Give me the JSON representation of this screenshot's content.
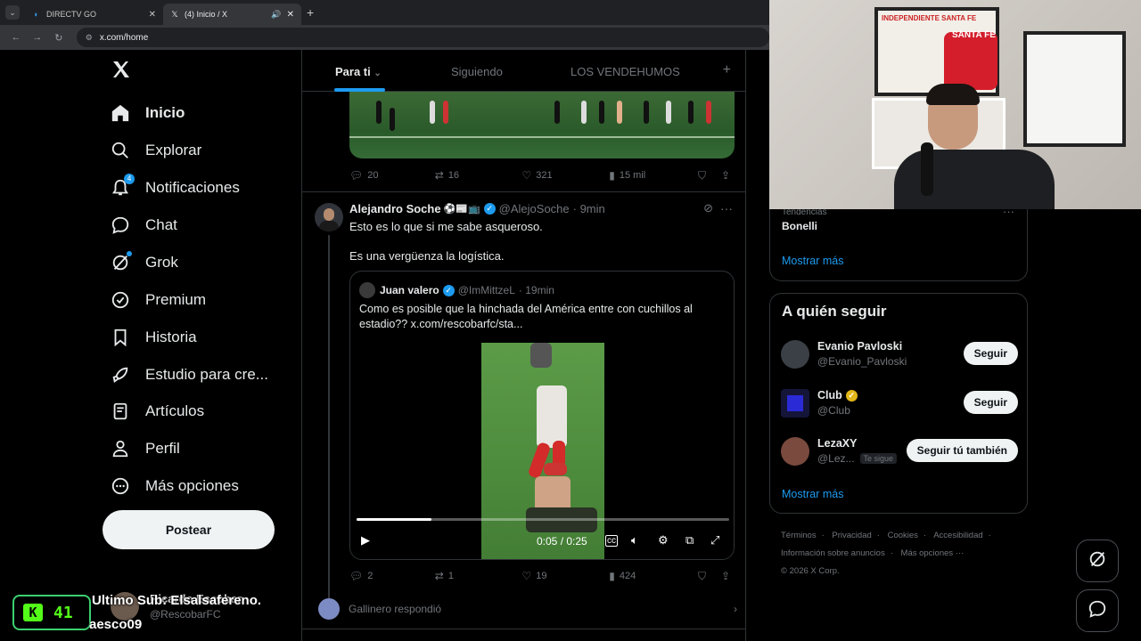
{
  "browser": {
    "tabs": [
      {
        "title": "DIRECTV GO",
        "icon": "directv-icon",
        "close": "✕"
      },
      {
        "title": "(4) Inicio / X",
        "icon": "x-logo-icon",
        "close": "✕",
        "audio": "🔊"
      }
    ],
    "new_tab": "+",
    "url": "x.com/home"
  },
  "nav": {
    "logo": "X",
    "items": [
      {
        "label": "Inicio",
        "icon": "home-icon"
      },
      {
        "label": "Explorar",
        "icon": "search-icon"
      },
      {
        "label": "Notificaciones",
        "icon": "bell-icon",
        "badge": "4"
      },
      {
        "label": "Chat",
        "icon": "chat-bubble-icon"
      },
      {
        "label": "Grok",
        "icon": "grok-icon"
      },
      {
        "label": "Premium",
        "icon": "premium-badge-icon"
      },
      {
        "label": "Historia",
        "icon": "bookmark-icon"
      },
      {
        "label": "Estudio para cre...",
        "icon": "rocket-icon"
      },
      {
        "label": "Artículos",
        "icon": "article-icon"
      },
      {
        "label": "Perfil",
        "icon": "person-icon"
      },
      {
        "label": "Más opciones",
        "icon": "more-circle-icon"
      }
    ],
    "post_button": "Postear",
    "account": {
      "name": "Ricardo Escobar",
      "handle": "@RescobarFC"
    }
  },
  "overlay": {
    "counter": "41",
    "counter_letter": "K",
    "sub_line": "Ultimo Sub: Elsalsafereno.",
    "sub_line2": "aesco09"
  },
  "timeline": {
    "tabs": [
      "Para ti",
      "Siguiendo",
      "LOS VENDEHUMOS"
    ],
    "plus": "+",
    "prev_actions": {
      "replies": "20",
      "reposts": "16",
      "likes": "321",
      "views": "15 mil"
    },
    "tweet": {
      "name": "Alejandro Soche",
      "emojis": "⚽📰📺",
      "handle": "@AlejoSoche",
      "time": "· 9min",
      "text1": "Esto es lo que si me sabe asqueroso.",
      "text2": "Es una vergüenza la logística.",
      "quote": {
        "name": "Juan valero",
        "handle": "@ImMittzeL",
        "time": "· 19min",
        "text": "Como es posible que la hinchada del América entre con cuchillos al estadio?? x.com/rescobarfc/sta...",
        "video_time": "0:05 / 0:25",
        "progress": 0.2
      },
      "actions": {
        "replies": "2",
        "reposts": "1",
        "likes": "19",
        "views": "424"
      }
    },
    "replied": "Gallinero respondió"
  },
  "right": {
    "trend_label": "Tendencias",
    "trend_name": "Bonelli",
    "show_more": "Mostrar más",
    "who_title": "A quién seguir",
    "who": [
      {
        "name": "Evanio Pavloski",
        "handle": "@Evanio_Pavloski",
        "button": "Seguir",
        "verified": false,
        "avatar_color": "#3b3f46"
      },
      {
        "name": "Club",
        "handle": "@Club",
        "button": "Seguir",
        "verified": true,
        "avatar_color": "#2a2ad6"
      },
      {
        "name": "LezaXY",
        "handle": "@Lez...",
        "button": "Seguir tú también",
        "follows_you": "Te sigue",
        "verified": false,
        "avatar_color": "#7a4a3e"
      }
    ],
    "show_more2": "Mostrar más",
    "footer": [
      "Términos",
      "Privacidad",
      "Cookies",
      "Accesibilidad",
      "Información sobre anuncios",
      "Más opciones ···",
      "© 2026 X Corp."
    ]
  },
  "webcam": {
    "jersey_text": "SANTA FE",
    "frame_text": "INDEPENDIENTE SANTA FE"
  },
  "colors": {
    "accent": "#1d9bf0",
    "background": "#000000",
    "border": "#2f3336",
    "muted": "#71767b",
    "gold": "#e2b719"
  }
}
